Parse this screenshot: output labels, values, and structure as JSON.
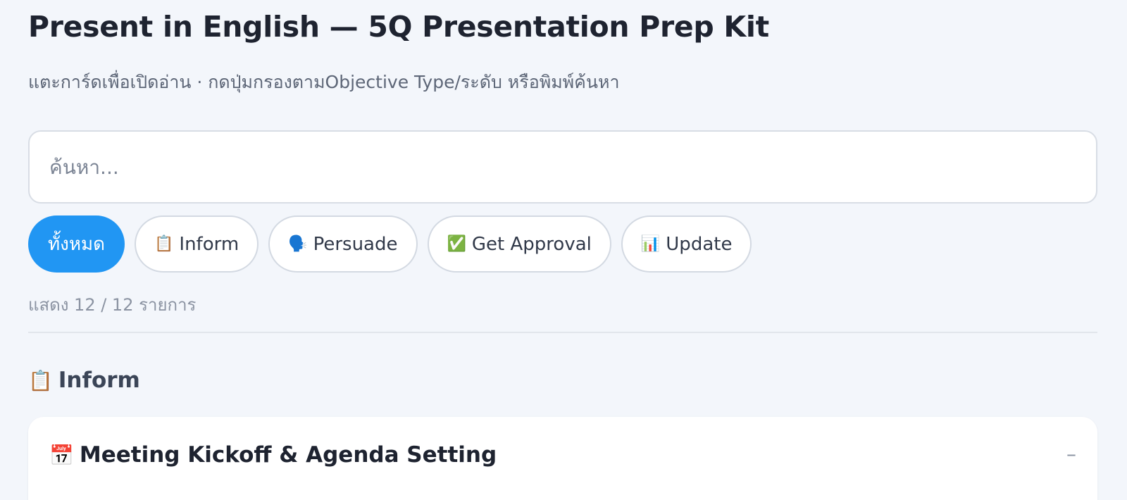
{
  "header": {
    "title": "Present in English — 5Q Presentation Prep Kit",
    "subtitle": "แตะการ์ดเพื่อเปิดอ่าน · กดปุ่มกรองตามObjective Type/ระดับ หรือพิมพ์ค้นหา"
  },
  "search": {
    "placeholder": "ค้นหา...",
    "value": ""
  },
  "filters": {
    "all": {
      "label": "ทั้งหมด",
      "active": true
    },
    "inform": {
      "icon": "📋",
      "icon_name": "clipboard-icon",
      "label": "Inform"
    },
    "persuade": {
      "icon": "🗣️",
      "icon_name": "speaking-head-icon",
      "label": "Persuade"
    },
    "approval": {
      "icon": "✅",
      "icon_name": "check-mark-icon",
      "label": "Get Approval"
    },
    "update": {
      "icon": "📊",
      "icon_name": "bar-chart-icon",
      "label": "Update"
    }
  },
  "results": {
    "count_text": "แสดง 12 / 12 รายการ"
  },
  "sections": [
    {
      "icon": "📋",
      "icon_name": "clipboard-icon",
      "title": "Inform",
      "cards": [
        {
          "icon": "📅",
          "icon_name": "calendar-icon",
          "title": "Meeting Kickoff & Agenda Setting",
          "toggle": "–",
          "expanded": true
        }
      ]
    }
  ],
  "colors": {
    "accent": "#2196f3",
    "background": "#f3f6fb",
    "text": "#1e2330",
    "muted": "#8b93a2"
  }
}
